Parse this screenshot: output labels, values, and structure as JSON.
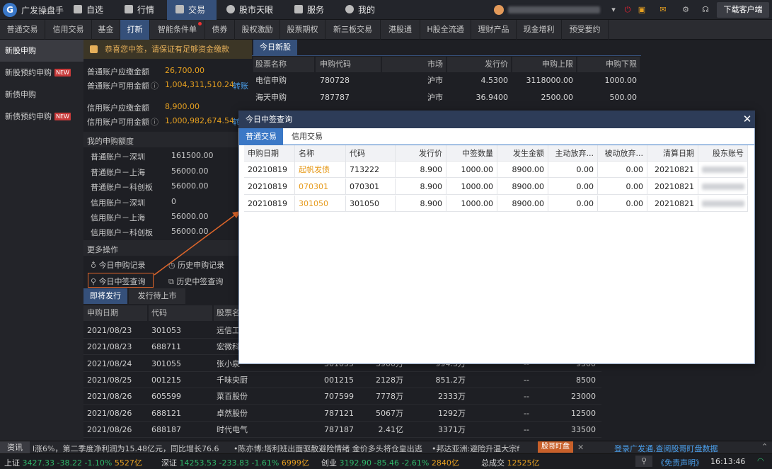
{
  "app": {
    "title": "广发操盘手",
    "logo_letter": "G"
  },
  "nav": [
    {
      "label": "自选",
      "icon": "plus-square-icon"
    },
    {
      "label": "行情",
      "icon": "chart-icon"
    },
    {
      "label": "交易",
      "icon": "hammer-icon",
      "active": true
    },
    {
      "label": "股市天眼",
      "icon": "eye-icon"
    },
    {
      "label": "服务",
      "icon": "briefcase-icon"
    },
    {
      "label": "我的",
      "icon": "user-icon"
    }
  ],
  "download_label": "下载客户端",
  "func_tabs": [
    "普通交易",
    "信用交易",
    "基金",
    "打新",
    "智能条件单",
    "债券",
    "股权激励",
    "股票期权",
    "新三板交易",
    "港股通",
    "H股全流通",
    "理财产品",
    "现金增利",
    "预受要约"
  ],
  "sidebar": [
    {
      "label": "新股申购",
      "badge": ""
    },
    {
      "label": "新股预约申购",
      "badge": "NEW"
    },
    {
      "label": "新债申购",
      "badge": ""
    },
    {
      "label": "新债预约申购",
      "badge": "NEW"
    }
  ],
  "notice": "恭喜您中签，请保证有足够资金缴款",
  "accounts": {
    "normal_due_label": "普通账户应缴金额",
    "normal_due": "26,700.00",
    "normal_avail_label": "普通账户可用金额",
    "normal_avail": "1,004,311,510.24",
    "credit_due_label": "信用账户应缴金额",
    "credit_due": "8,900.00",
    "credit_avail_label": "信用账户可用金额",
    "credit_avail": "1,000,982,674.54",
    "transfer_label": "转账"
  },
  "quota": {
    "title": "我的申购额度",
    "rows": [
      {
        "label": "普通账户－深圳",
        "value": "161500.00"
      },
      {
        "label": "普通账户－上海",
        "value": "56000.00"
      },
      {
        "label": "普通账户－科创板",
        "value": "56000.00"
      },
      {
        "label": "信用账户－深圳",
        "value": "0"
      },
      {
        "label": "信用账户－上海",
        "value": "56000.00"
      },
      {
        "label": "信用账户－科创板",
        "value": "56000.00"
      }
    ]
  },
  "more": {
    "title": "更多操作",
    "today_apply": "今日申购记录",
    "hist_apply": "历史申购记录",
    "today_win": "今日中签查询",
    "hist_win": "历史中签查询"
  },
  "today_new": {
    "tab": "今日新股",
    "headers": [
      "股票名称",
      "申购代码",
      "市场",
      "发行价",
      "申购上限",
      "申购下限"
    ],
    "rows": [
      [
        "电信申购",
        "780728",
        "沪市",
        "4.5300",
        "3118000.00",
        "1000.00"
      ],
      [
        "海天申购",
        "787787",
        "沪市",
        "36.9400",
        "2500.00",
        "500.00"
      ]
    ]
  },
  "upcoming": {
    "tabs": [
      "即将发行",
      "发行待上市"
    ],
    "headers": [
      "申购日期",
      "代码",
      "股票名称"
    ],
    "rows": [
      [
        "2021/08/23",
        "301053",
        "远信工",
        "",
        "",
        "",
        "",
        "",
        ""
      ],
      [
        "2021/08/23",
        "688711",
        "宏微科",
        "",
        "",
        "",
        "",
        "",
        ""
      ],
      [
        "2021/08/24",
        "301055",
        "张小泉",
        "301055",
        "3900万",
        "994.3万",
        "--",
        "9500",
        ""
      ],
      [
        "2021/08/25",
        "001215",
        "千味央厨",
        "001215",
        "2128万",
        "851.2万",
        "--",
        "8500",
        ""
      ],
      [
        "2021/08/26",
        "605599",
        "菜百股份",
        "707599",
        "7778万",
        "2333万",
        "--",
        "23000",
        ""
      ],
      [
        "2021/08/26",
        "688121",
        "卓然股份",
        "787121",
        "5067万",
        "1292万",
        "--",
        "12500",
        ""
      ],
      [
        "2021/08/26",
        "688187",
        "时代电气",
        "787187",
        "2.41亿",
        "3371万",
        "--",
        "33500",
        ""
      ]
    ]
  },
  "modal": {
    "title": "今日中签查询",
    "tabs": [
      "普通交易",
      "信用交易"
    ],
    "headers": [
      "申购日期",
      "名称",
      "代码",
      "发行价",
      "中签数量",
      "发生金额",
      "主动放弃...",
      "被动放弃...",
      "清算日期",
      "股东账号"
    ],
    "rows": [
      [
        "20210819",
        "起帆发债",
        "713222",
        "8.900",
        "1000.00",
        "8900.00",
        "0.00",
        "0.00",
        "20210821",
        ""
      ],
      [
        "20210819",
        "070301",
        "070301",
        "8.900",
        "1000.00",
        "8900.00",
        "0.00",
        "0.00",
        "20210821",
        ""
      ],
      [
        "20210819",
        "301050",
        "301050",
        "8.900",
        "1000.00",
        "8900.00",
        "0.00",
        "0.00",
        "20210821",
        ""
      ]
    ]
  },
  "news": {
    "tag": "资讯",
    "items": [
      "l涨6%，第二季度净利润为15.48亿元，同比增长76.6%",
      "•陈亦博:塔利班出面驱散避险情绪 金价多头将仓皇出逃",
      "•邦达亚洲:避险升温大宗f"
    ],
    "btn": "股哥盯盘",
    "close": "✕",
    "right": "登录广发通,查阅股哥盯盘数据"
  },
  "status": {
    "sh": {
      "label": "上证",
      "value": "3427.33",
      "change": "-38.22",
      "pct": "-1.10%",
      "amount": "5527亿"
    },
    "sz": {
      "label": "深证",
      "value": "14253.53",
      "change": "-233.83",
      "pct": "-1.61%",
      "amount": "6999亿"
    },
    "cy": {
      "label": "创业",
      "value": "3192.90",
      "change": "-85.46",
      "pct": "-2.61%",
      "amount": "2840亿"
    },
    "total_label": "总成交",
    "total": "12525亿",
    "disclaimer": "《免责声明》",
    "time": "16:13:46"
  },
  "colors": {
    "accent": "#35507a",
    "modal_tab": "#3b78c6",
    "orange": "#e6a020",
    "green": "#2fb86a"
  }
}
